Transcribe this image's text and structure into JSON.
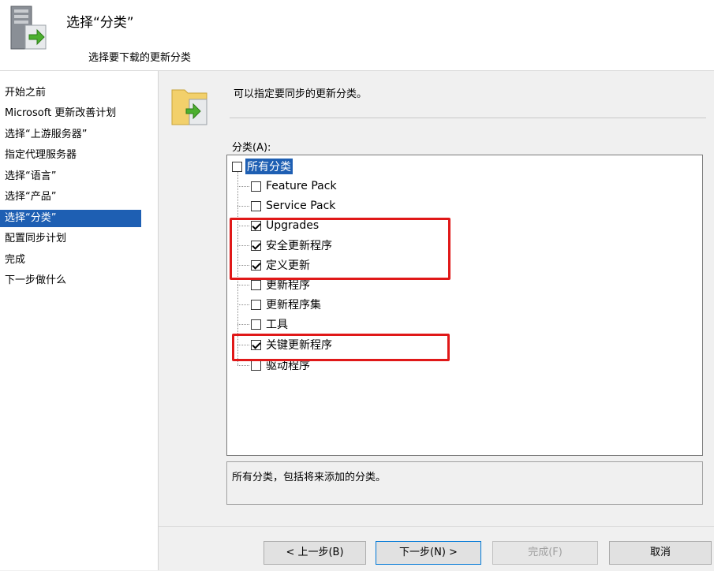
{
  "header": {
    "title": "选择“分类”",
    "subtitle": "选择要下载的更新分类"
  },
  "sidebar": {
    "items": [
      {
        "label": "开始之前"
      },
      {
        "label": "Microsoft 更新改善计划"
      },
      {
        "label": "选择“上游服务器”"
      },
      {
        "label": "指定代理服务器"
      },
      {
        "label": "选择“语言”"
      },
      {
        "label": "选择“产品”"
      },
      {
        "label": "选择“分类”",
        "selected": true
      },
      {
        "label": "配置同步计划"
      },
      {
        "label": "完成"
      },
      {
        "label": "下一步做什么"
      }
    ]
  },
  "main": {
    "description": "可以指定要同步的更新分类。",
    "list_label": "分类(A):",
    "tree": {
      "root": {
        "label": "所有分类",
        "checked": false,
        "highlighted": true
      },
      "children": [
        {
          "label": "Feature Pack",
          "checked": false
        },
        {
          "label": "Service Pack",
          "checked": false
        },
        {
          "label": "Upgrades",
          "checked": true
        },
        {
          "label": "安全更新程序",
          "checked": true
        },
        {
          "label": "定义更新",
          "checked": true
        },
        {
          "label": "更新程序",
          "checked": false
        },
        {
          "label": "更新程序集",
          "checked": false
        },
        {
          "label": "工具",
          "checked": false
        },
        {
          "label": "关键更新程序",
          "checked": true
        },
        {
          "label": "驱动程序",
          "checked": false
        }
      ]
    },
    "detail_text": "所有分类，包括将来添加的分类。"
  },
  "buttons": {
    "back": "< 上一步(B)",
    "next": "下一步(N) >",
    "finish": "完成(F)",
    "cancel": "取消"
  },
  "colors": {
    "selection": "#1e5fb3",
    "annotation": "#e01818"
  }
}
